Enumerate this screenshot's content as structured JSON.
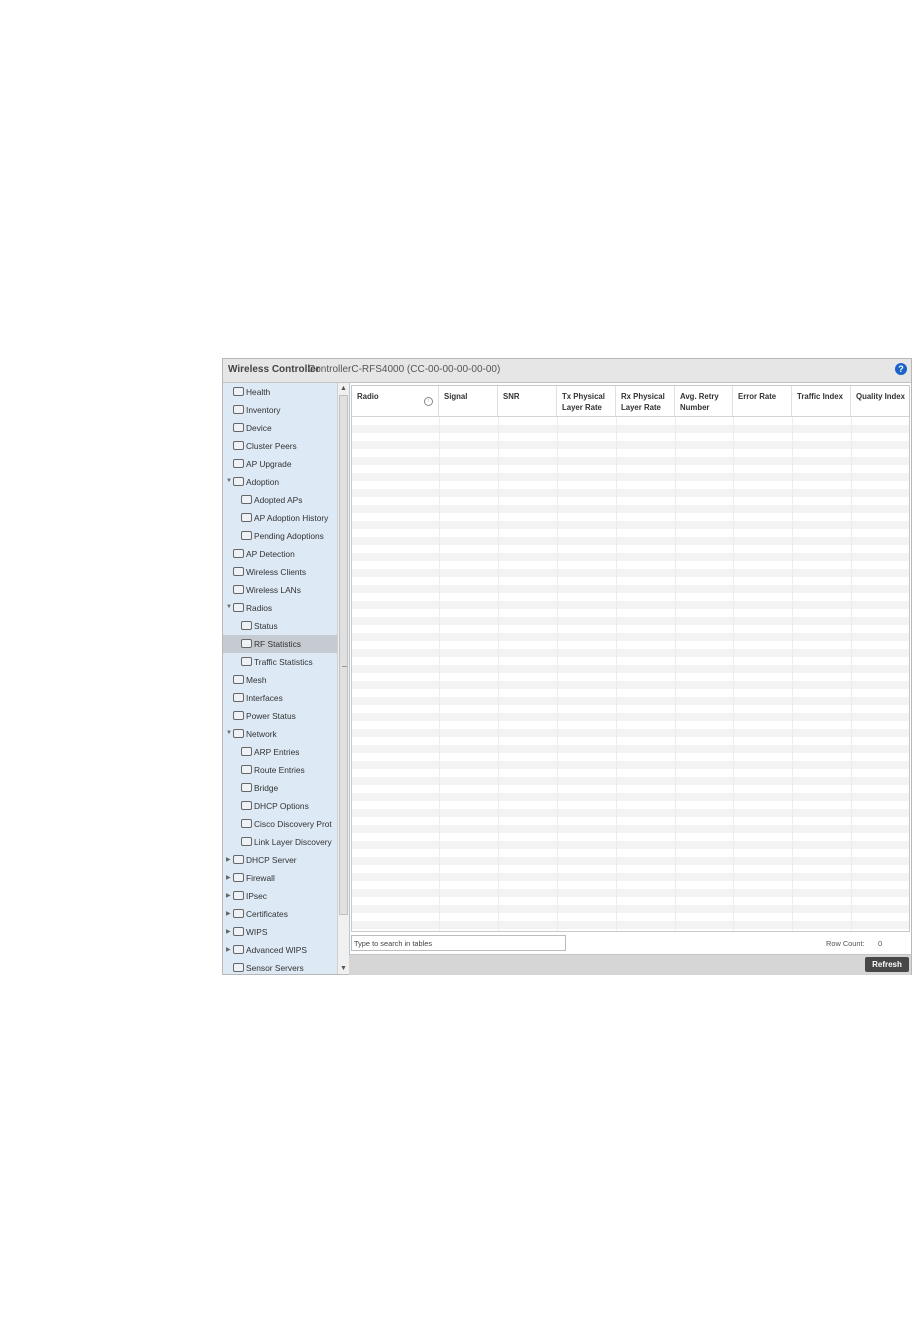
{
  "header": {
    "app_title": "Wireless Controller",
    "device_title": "ControllerC-RFS4000 (CC-00-00-00-00-00)",
    "help_icon": "help-icon",
    "help_symbol": "?"
  },
  "sidebar": {
    "scroll_up": "▲",
    "scroll_down": "▼",
    "items": [
      {
        "label": "Health",
        "icon": "health-icon",
        "depth": 1,
        "expander": ""
      },
      {
        "label": "Inventory",
        "icon": "inventory-icon",
        "depth": 1,
        "expander": ""
      },
      {
        "label": "Device",
        "icon": "device-icon",
        "depth": 1,
        "expander": ""
      },
      {
        "label": "Cluster Peers",
        "icon": "cluster-peers-icon",
        "depth": 1,
        "expander": ""
      },
      {
        "label": "AP Upgrade",
        "icon": "ap-upgrade-icon",
        "depth": 1,
        "expander": ""
      },
      {
        "label": "Adoption",
        "icon": "adoption-icon",
        "depth": 1,
        "expander": "▼"
      },
      {
        "label": "Adopted APs",
        "icon": "adopted-aps-icon",
        "depth": 2,
        "expander": ""
      },
      {
        "label": "AP Adoption History",
        "icon": "adoption-history-icon",
        "depth": 2,
        "expander": ""
      },
      {
        "label": "Pending Adoptions",
        "icon": "pending-adoptions-icon",
        "depth": 2,
        "expander": ""
      },
      {
        "label": "AP Detection",
        "icon": "ap-detection-icon",
        "depth": 1,
        "expander": ""
      },
      {
        "label": "Wireless Clients",
        "icon": "wireless-clients-icon",
        "depth": 1,
        "expander": ""
      },
      {
        "label": "Wireless LANs",
        "icon": "wireless-lans-icon",
        "depth": 1,
        "expander": ""
      },
      {
        "label": "Radios",
        "icon": "radios-icon",
        "depth": 1,
        "expander": "▼"
      },
      {
        "label": "Status",
        "icon": "radio-status-icon",
        "depth": 2,
        "expander": ""
      },
      {
        "label": "RF Statistics",
        "icon": "rf-statistics-icon",
        "depth": 2,
        "expander": "",
        "selected": true
      },
      {
        "label": "Traffic Statistics",
        "icon": "traffic-statistics-icon",
        "depth": 2,
        "expander": ""
      },
      {
        "label": "Mesh",
        "icon": "mesh-icon",
        "depth": 1,
        "expander": ""
      },
      {
        "label": "Interfaces",
        "icon": "interfaces-icon",
        "depth": 1,
        "expander": ""
      },
      {
        "label": "Power Status",
        "icon": "power-status-icon",
        "depth": 1,
        "expander": ""
      },
      {
        "label": "Network",
        "icon": "network-icon",
        "depth": 1,
        "expander": "▼"
      },
      {
        "label": "ARP Entries",
        "icon": "arp-entries-icon",
        "depth": 2,
        "expander": ""
      },
      {
        "label": "Route Entries",
        "icon": "route-entries-icon",
        "depth": 2,
        "expander": ""
      },
      {
        "label": "Bridge",
        "icon": "bridge-icon",
        "depth": 2,
        "expander": ""
      },
      {
        "label": "DHCP Options",
        "icon": "dhcp-options-icon",
        "depth": 2,
        "expander": ""
      },
      {
        "label": "Cisco Discovery Prot",
        "icon": "cisco-discovery-icon",
        "depth": 2,
        "expander": ""
      },
      {
        "label": "Link Layer Discovery",
        "icon": "link-layer-discovery-icon",
        "depth": 2,
        "expander": ""
      },
      {
        "label": "DHCP Server",
        "icon": "dhcp-server-icon",
        "depth": 1,
        "expander": "▶"
      },
      {
        "label": "Firewall",
        "icon": "firewall-icon",
        "depth": 1,
        "expander": "▶"
      },
      {
        "label": "IPsec",
        "icon": "ipsec-icon",
        "depth": 1,
        "expander": "▶"
      },
      {
        "label": "Certificates",
        "icon": "certificates-icon",
        "depth": 1,
        "expander": "▶"
      },
      {
        "label": "WIPS",
        "icon": "wips-icon",
        "depth": 1,
        "expander": "▶"
      },
      {
        "label": "Advanced WIPS",
        "icon": "advanced-wips-icon",
        "depth": 1,
        "expander": "▶"
      },
      {
        "label": "Sensor Servers",
        "icon": "sensor-servers-icon",
        "depth": 1,
        "expander": ""
      }
    ]
  },
  "table": {
    "sort_icon": "sort-icon",
    "sort_symbol": "↑",
    "columns": [
      {
        "label": "Radio"
      },
      {
        "label": "Signal"
      },
      {
        "label": "SNR"
      },
      {
        "label": "Tx Physical Layer Rate"
      },
      {
        "label": "Rx Physical Layer Rate"
      },
      {
        "label": "Avg. Retry Number"
      },
      {
        "label": "Error Rate"
      },
      {
        "label": "Traffic Index"
      },
      {
        "label": "Quality Index"
      }
    ]
  },
  "footer": {
    "search_value": "Type to search in tables",
    "row_count_label": "Row Count:",
    "row_count_value": "0"
  },
  "actions": {
    "refresh_label": "Refresh"
  }
}
